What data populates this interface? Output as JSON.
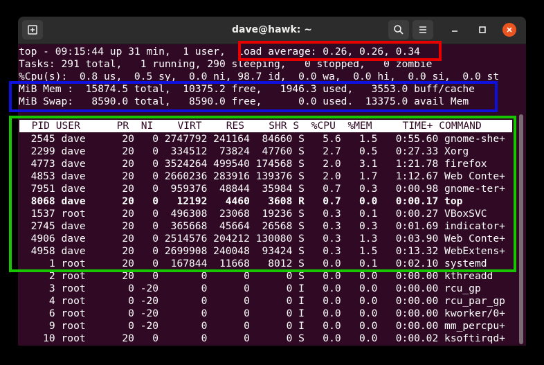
{
  "window": {
    "title": "dave@hawk: ~",
    "colors": {
      "terminal_bg": "#300a24",
      "titlebar_bg": "#2c2c2c",
      "close": "#e95420"
    },
    "icons": [
      "new-tab-icon",
      "search-icon",
      "hamburger-menu-icon",
      "minimize-icon",
      "maximize-icon",
      "close-icon"
    ]
  },
  "terminal": {
    "summary": [
      "top - 09:15:44 up 31 min,  1 user,  load average: 0.26, 0.26, 0.34",
      "Tasks: 291 total,   1 running, 290 sleeping,   0 stopped,   0 zombie",
      "%Cpu(s):  0.8 us,  0.5 sy,  0.0 ni, 98.7 id,  0.0 wa,  0.0 hi,  0.0 si,  0.0 st",
      "MiB Mem :  15874.5 total,  10375.2 free,   1946.3 used,   3553.0 buff/cache",
      "MiB Swap:   8590.0 total,   8590.0 free,      0.0 used.  13375.0 avail Mem"
    ],
    "header": "  PID USER      PR  NI    VIRT    RES    SHR S  %CPU  %MEM     TIME+ COMMAND",
    "processes": [
      "  2545 dave      20   0 2747792 241164  84660 S   5.6   1.5   0:55.60 gnome-she+",
      "  2299 dave      20   0  334512  73824  47760 S   2.7   0.5   0:27.33 Xorg",
      "  4773 dave      20   0 3524264 499540 174568 S   2.0   3.1   1:21.78 firefox",
      "  4853 dave      20   0 2660236 283916 139376 S   2.0   1.7   1:12.67 Web Conte+",
      "  7951 dave      20   0  959376  48844  35984 S   0.7   0.3   0:00.98 gnome-ter+",
      "  8068 dave      20   0   12192   4460   3608 R   0.7   0.0   0:00.17 top",
      "  1537 root      20   0  496308  23068  19236 S   0.3   0.1   0:00.27 VBoxSVC",
      "  2745 dave      20   0  365668  45664  26568 S   0.3   0.3   0:01.69 indicator+",
      "  4906 dave      20   0 2514576 204212 130080 S   0.3   1.3   0:03.90 Web Conte+",
      "  4958 dave      20   0 2699908 240048  93424 S   0.3   1.5   0:13.32 WebExtens+",
      "     1 root      20   0  167844  11668   8012 S   0.0   0.1   0:02.10 systemd",
      "     2 root      20   0       0      0      0 S   0.0   0.0   0:00.00 kthreadd",
      "     3 root       0 -20       0      0      0 I   0.0   0.0   0:00.00 rcu_gp",
      "     4 root       0 -20       0      0      0 I   0.0   0.0   0:00.00 rcu_par_gp",
      "     6 root       0 -20       0      0      0 I   0.0   0.0   0:00.00 kworker/0+",
      "     9 root       0 -20       0      0      0 I   0.0   0.0   0:00.00 mm_percpu+",
      "    10 root      20   0       0      0      0 S   0.0   0.0   0:00.02 ksoftirqd+"
    ],
    "bold_row_index": 5
  },
  "highlights": {
    "red": "#e80000",
    "blue": "#1010dd",
    "green": "#17c500"
  }
}
